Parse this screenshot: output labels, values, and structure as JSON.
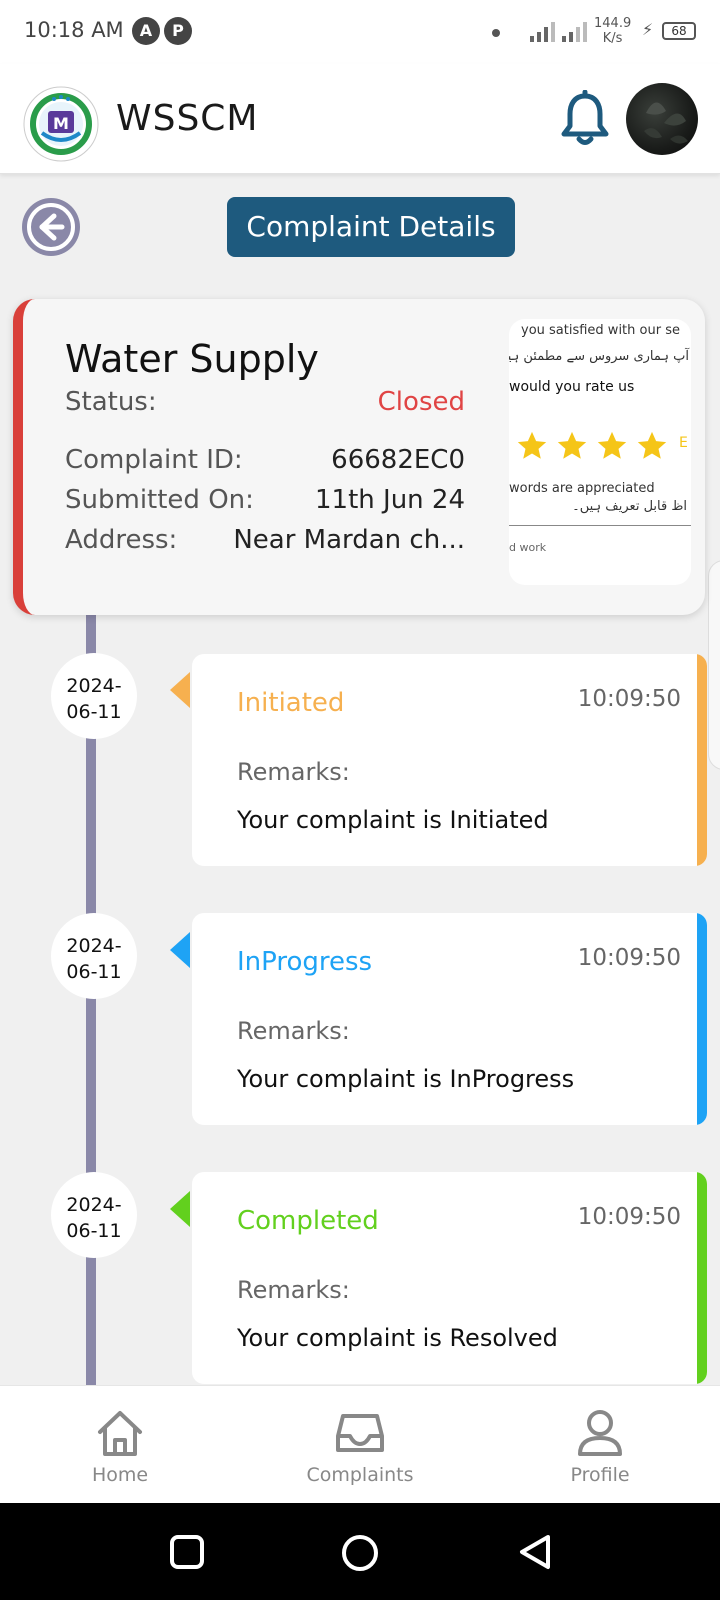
{
  "status_bar": {
    "time": "10:18 AM",
    "app_icon_1": "A",
    "app_icon_2": "P",
    "speed_value": "144.9",
    "speed_unit": "K/s",
    "battery": "68"
  },
  "header": {
    "app_name": "WSSCM",
    "logo_letter": "M"
  },
  "page": {
    "title": "Complaint Details"
  },
  "summary": {
    "category": "Water Supply",
    "status_label": "Status:",
    "status_value": "Closed",
    "id_label": "Complaint ID:",
    "id_value": "66682EC0",
    "submitted_label": "Submitted On:",
    "submitted_value": "11th Jun 24",
    "address_label": "Address:",
    "address_value": "Near Mardan ch..."
  },
  "rating_panel": {
    "question_en": "you satisfied with our se",
    "question_ur": "آپ ہماری سروس سے مطمئن ہیں",
    "rate_prompt": "would you rate us",
    "stars": 4,
    "star_suffix": "E",
    "appreciation_en": "words are appreciated",
    "appreciation_ur": "اظ قابل تعریف ہیں۔",
    "feedback_hint": "d work"
  },
  "timeline": [
    {
      "date_line1": "2024-",
      "date_line2": "06-11",
      "status": "Initiated",
      "time": "10:09:50",
      "remarks_label": "Remarks:",
      "remarks": "Your complaint is Initiated",
      "color": "#f6b04f"
    },
    {
      "date_line1": "2024-",
      "date_line2": "06-11",
      "status": "InProgress",
      "time": "10:09:50",
      "remarks_label": "Remarks:",
      "remarks": "Your complaint is InProgress",
      "color": "#1ea3f5"
    },
    {
      "date_line1": "2024-",
      "date_line2": "06-11",
      "status": "Completed",
      "time": "10:09:50",
      "remarks_label": "Remarks:",
      "remarks": "Your complaint is Resolved",
      "color": "#62d01e"
    }
  ],
  "bottom_nav": {
    "home": "Home",
    "complaints": "Complaints",
    "profile": "Profile"
  },
  "colors": {
    "primary": "#1e5a7e",
    "closed": "#e04444",
    "timeline": "#8a88a8"
  }
}
